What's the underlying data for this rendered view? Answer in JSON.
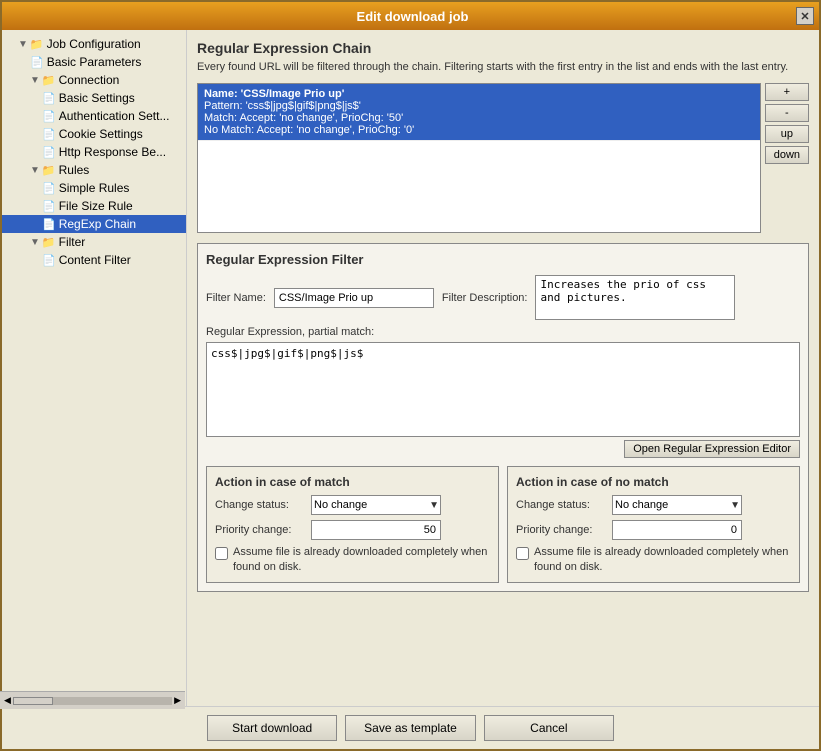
{
  "window": {
    "title": "Edit download job",
    "close_label": "✕"
  },
  "sidebar": {
    "items": [
      {
        "id": "job-config",
        "label": "Job Configuration",
        "indent": 0,
        "type": "folder",
        "expanded": true
      },
      {
        "id": "basic-params",
        "label": "Basic Parameters",
        "indent": 1,
        "type": "doc"
      },
      {
        "id": "connection",
        "label": "Connection",
        "indent": 1,
        "type": "folder",
        "expanded": true
      },
      {
        "id": "basic-settings",
        "label": "Basic Settings",
        "indent": 2,
        "type": "doc"
      },
      {
        "id": "auth-settings",
        "label": "Authentication Sett...",
        "indent": 2,
        "type": "doc"
      },
      {
        "id": "cookie-settings",
        "label": "Cookie Settings",
        "indent": 2,
        "type": "doc"
      },
      {
        "id": "http-response",
        "label": "Http Response Be...",
        "indent": 2,
        "type": "doc"
      },
      {
        "id": "rules",
        "label": "Rules",
        "indent": 1,
        "type": "folder",
        "expanded": true
      },
      {
        "id": "simple-rules",
        "label": "Simple Rules",
        "indent": 2,
        "type": "doc"
      },
      {
        "id": "file-size-rule",
        "label": "File Size Rule",
        "indent": 2,
        "type": "doc"
      },
      {
        "id": "regexp-chain",
        "label": "RegExp Chain",
        "indent": 2,
        "type": "doc",
        "selected": true
      },
      {
        "id": "filter",
        "label": "Filter",
        "indent": 1,
        "type": "folder",
        "expanded": true
      },
      {
        "id": "content-filter",
        "label": "Content Filter",
        "indent": 2,
        "type": "doc"
      }
    ]
  },
  "main": {
    "section_title": "Regular Expression Chain",
    "section_desc": "Every found URL will be filtered through the chain. Filtering starts with the first entry in the list and ends with the last entry.",
    "chain_buttons": {
      "add": "+",
      "remove": "-",
      "up": "up",
      "down": "down"
    },
    "chain_items": [
      {
        "name": "Name: 'CSS/Image Prio up'",
        "pattern": "Pattern: 'css$|jpg$|gif$|png$|js$'",
        "match": "Match: Accept: 'no change', PrioChg: '50'",
        "no_match": "No Match: Accept: 'no change', PrioChg: '0'",
        "selected": true
      }
    ],
    "filter_section": {
      "title": "Regular Expression Filter",
      "filter_name_label": "Filter Name:",
      "filter_name_value": "CSS/Image Prio up",
      "filter_desc_label": "Filter Description:",
      "filter_desc_value": "Increases the prio of css and pictures.",
      "regex_label": "Regular Expression, partial match:",
      "regex_value": "css$|jpg$|gif$|png$|js$",
      "open_editor_btn": "Open Regular Expression Editor"
    },
    "match_section": {
      "title": "Action in case of match",
      "change_status_label": "Change status:",
      "change_status_value": "No change",
      "priority_label": "Priority change:",
      "priority_value": "50",
      "assume_label": "Assume file is already downloaded completely when found on disk."
    },
    "no_match_section": {
      "title": "Action in case of no match",
      "change_status_label": "Change status:",
      "change_status_value": "No change",
      "priority_label": "Priority change:",
      "priority_value": "0",
      "assume_label": "Assume file is already downloaded completely when found on disk."
    }
  },
  "bottom_buttons": {
    "start_download": "Start download",
    "save_template": "Save as template",
    "cancel": "Cancel"
  }
}
